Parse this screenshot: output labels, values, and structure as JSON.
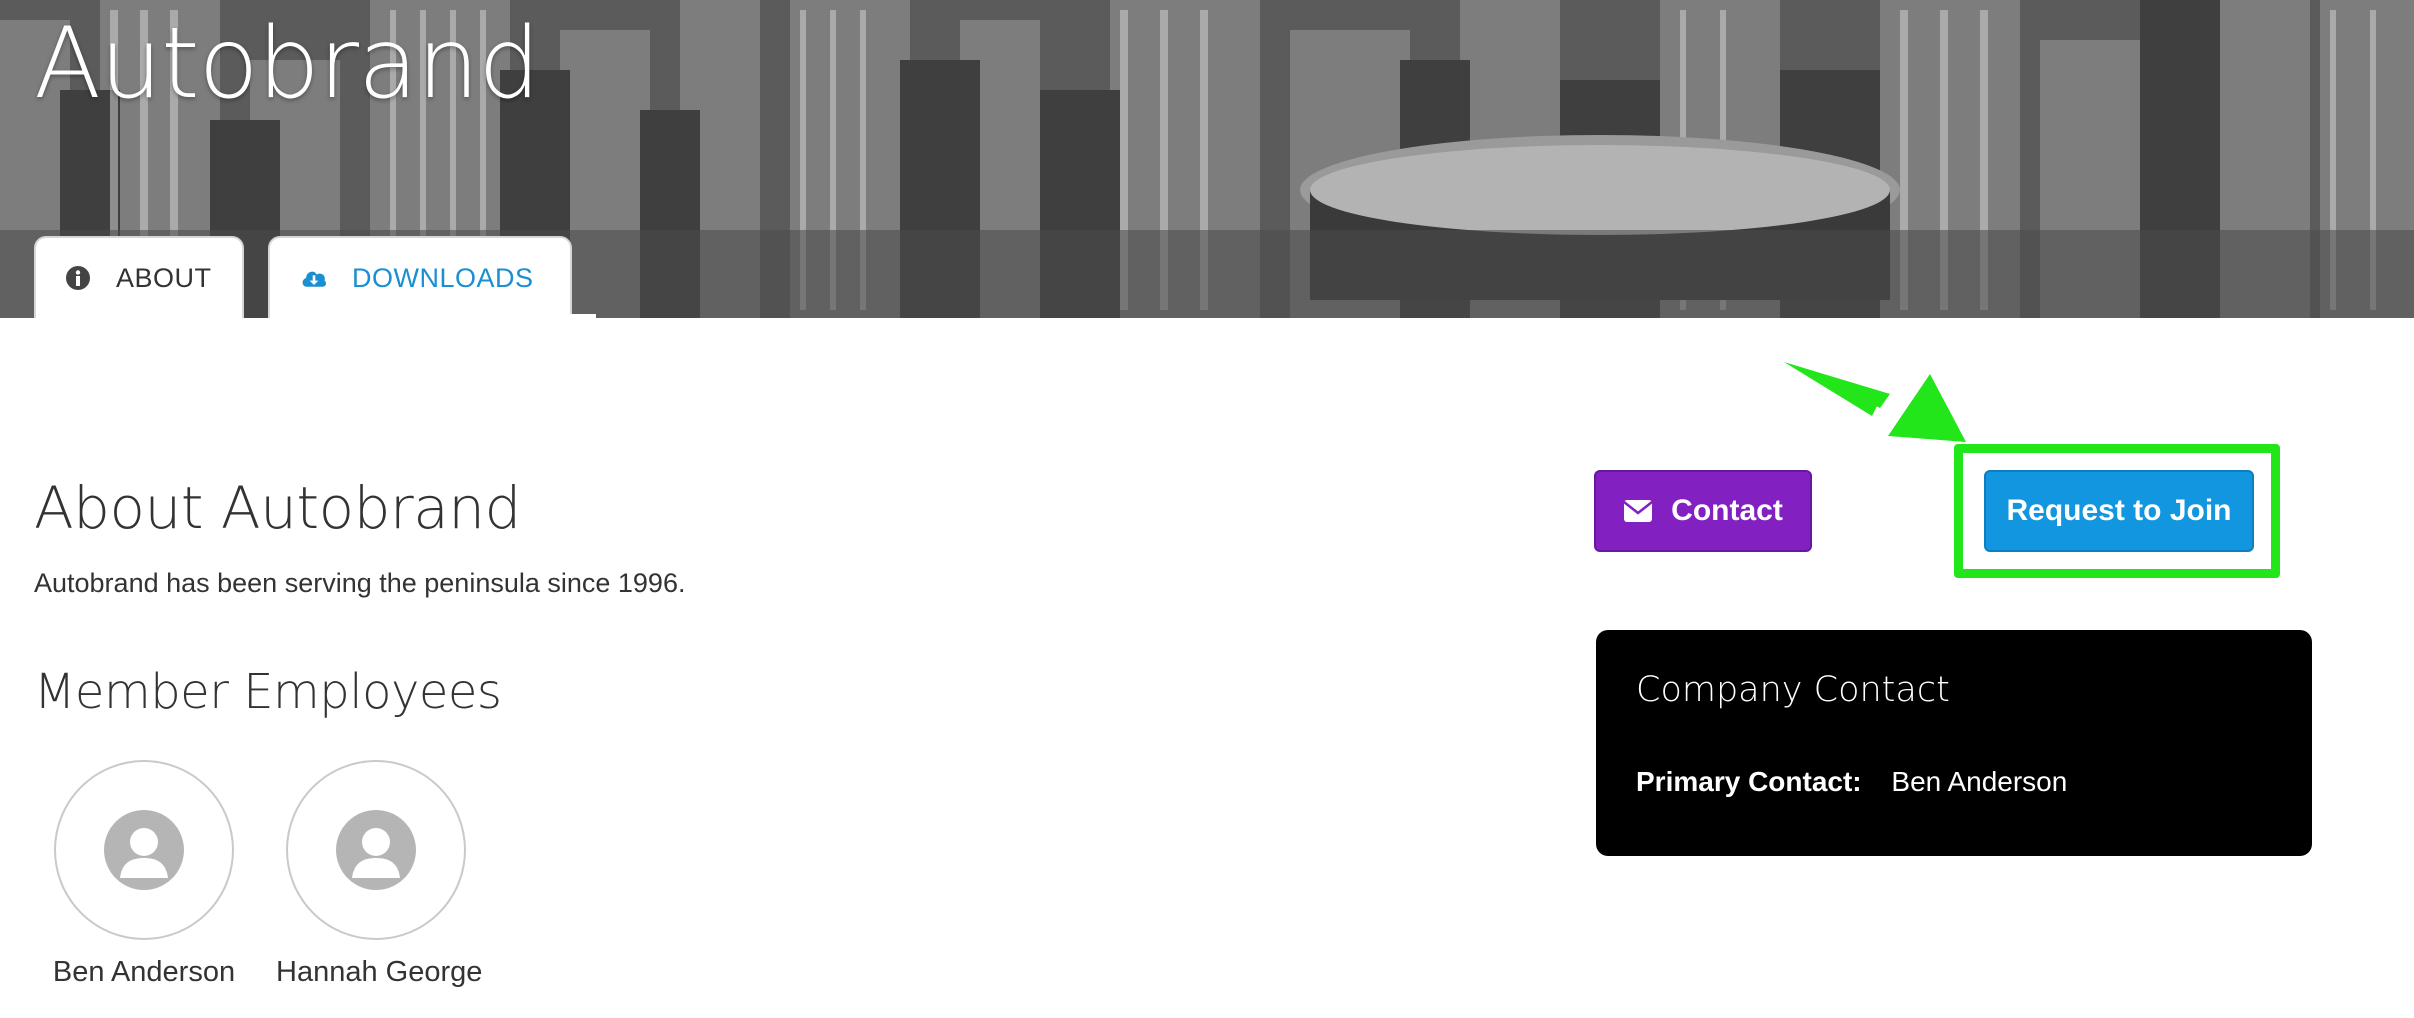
{
  "hero": {
    "title": "Autobrand"
  },
  "tabs": [
    {
      "label": "ABOUT",
      "icon": "info-icon",
      "active": false
    },
    {
      "label": "DOWNLOADS",
      "icon": "cloud-download-icon",
      "active": true
    }
  ],
  "about": {
    "heading": "About Autobrand",
    "description": "Autobrand has been serving the peninsula since 1996."
  },
  "members": {
    "heading": "Member Employees",
    "people": [
      {
        "name": "Ben Anderson"
      },
      {
        "name": "Hannah George"
      }
    ]
  },
  "actions": {
    "contact_label": "Contact",
    "join_label": "Request to Join"
  },
  "company_contact": {
    "title": "Company Contact",
    "primary_label": "Primary Contact:",
    "primary_value": "Ben Anderson"
  },
  "colors": {
    "contact_button": "#8320c2",
    "join_button": "#1296df",
    "highlight": "#22e51a",
    "downloads_tab_text": "#1a8fd1",
    "card_background": "#000000"
  }
}
